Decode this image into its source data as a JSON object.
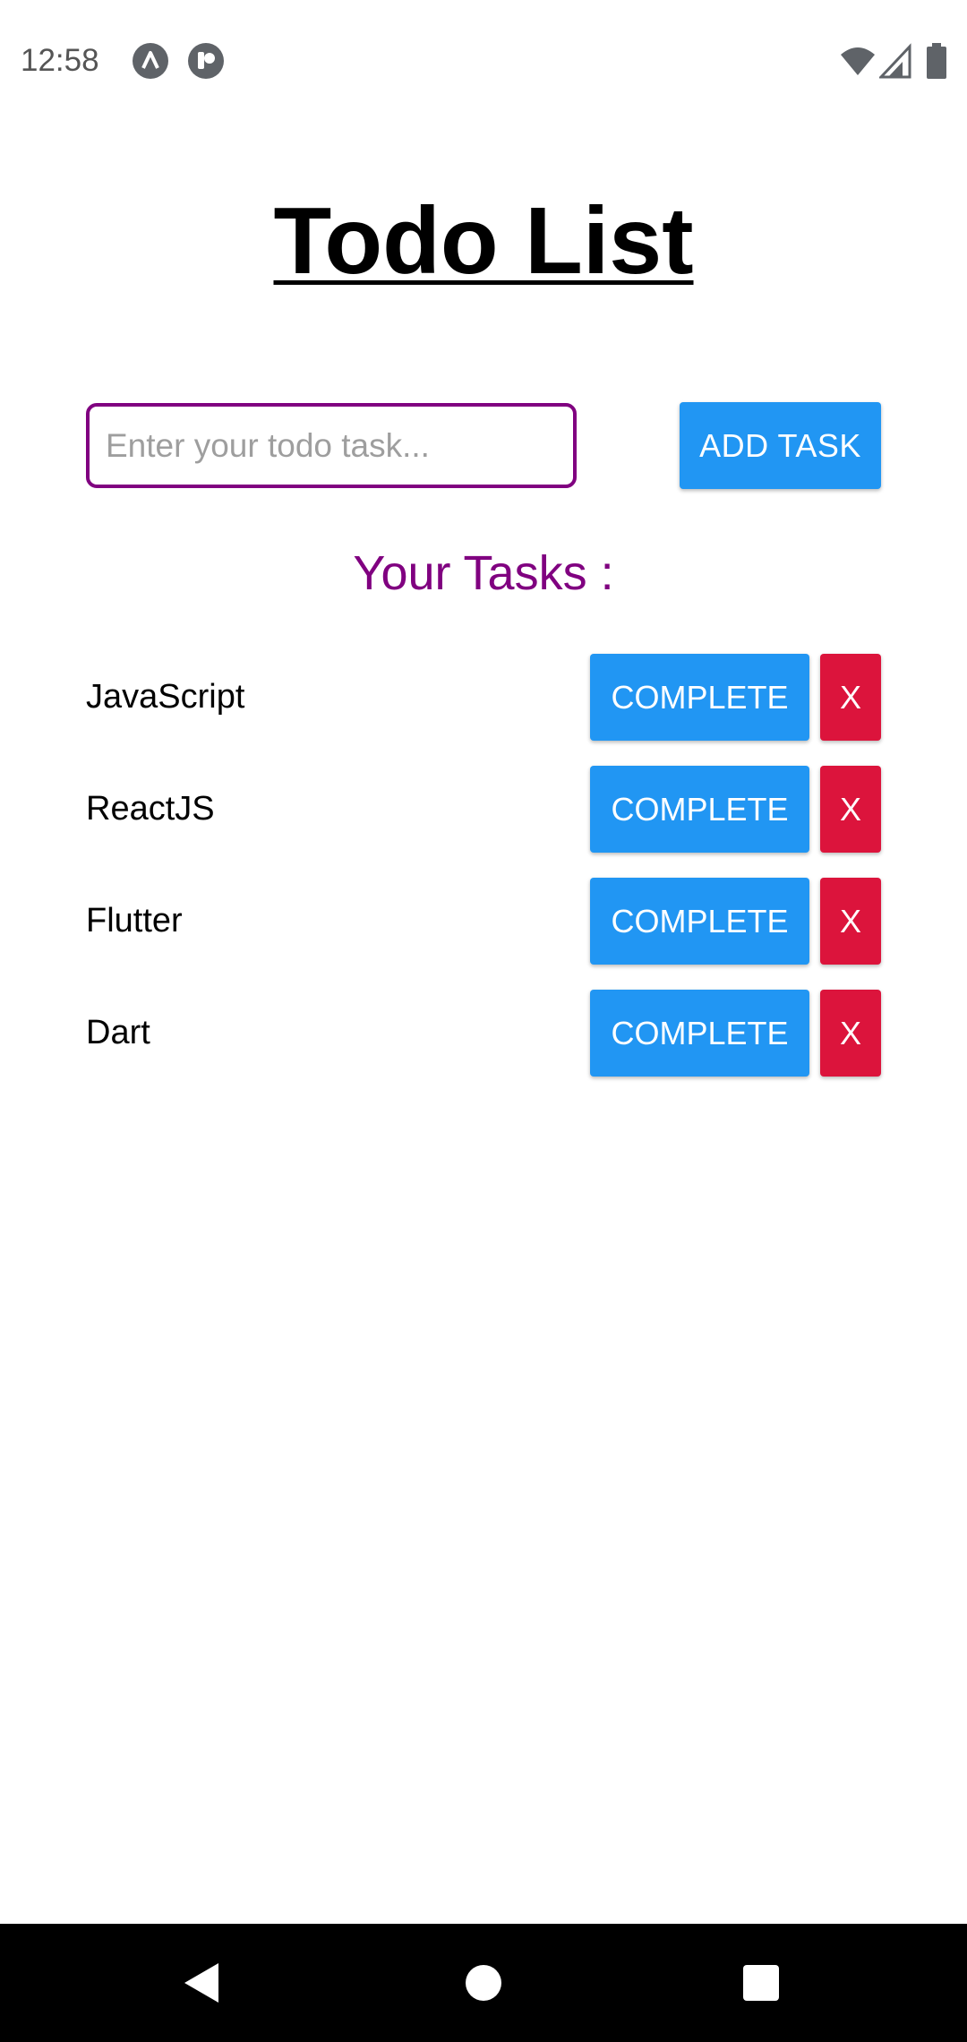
{
  "status_bar": {
    "time": "12:58",
    "left_icons": [
      "app-notification-icon",
      "pocket-notification-icon"
    ],
    "right_icons": [
      "wifi-icon",
      "cell-signal-icon",
      "battery-icon"
    ]
  },
  "title": "Todo List",
  "input": {
    "placeholder": "Enter your todo task...",
    "value": ""
  },
  "add_button_label": "ADD TASK",
  "tasks_heading": "Your Tasks :",
  "tasks": [
    {
      "name": "JavaScript",
      "complete_label": "COMPLETE",
      "delete_label": "X"
    },
    {
      "name": "ReactJS",
      "complete_label": "COMPLETE",
      "delete_label": "X"
    },
    {
      "name": "Flutter",
      "complete_label": "COMPLETE",
      "delete_label": "X"
    },
    {
      "name": "Dart",
      "complete_label": "COMPLETE",
      "delete_label": "X"
    }
  ],
  "nav_bar": {
    "buttons": [
      "back-icon",
      "home-icon",
      "recents-icon"
    ]
  },
  "colors": {
    "accent_purple": "#800080",
    "button_blue": "#2196f3",
    "delete_red": "#dc143c",
    "nav_background": "#000000"
  }
}
